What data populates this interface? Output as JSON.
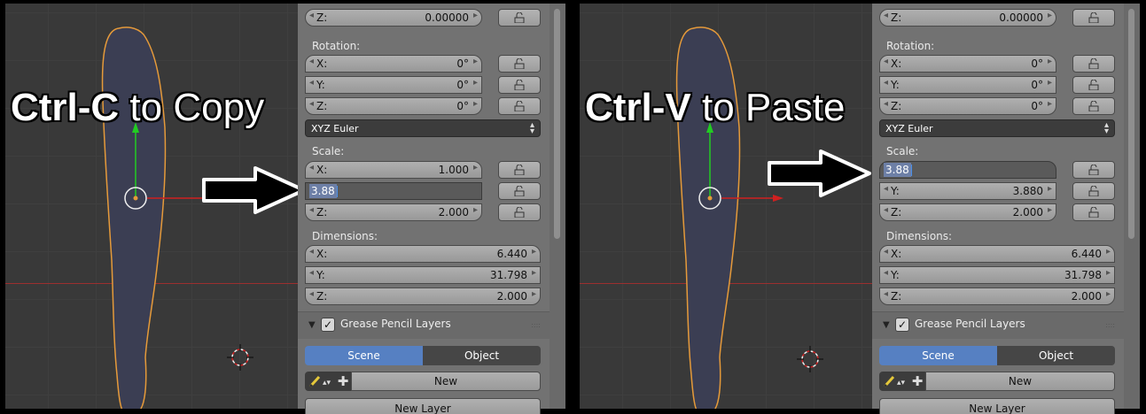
{
  "colors": {
    "selection_outline": "#e59a3a",
    "x_axis": "#d02020",
    "y_axis": "#22cc22",
    "scene_active": "#5680c2"
  },
  "left": {
    "caption": {
      "key": "Ctrl-C",
      "rest": " to Copy"
    },
    "properties": {
      "top_z": {
        "label": "Z:",
        "value": "0.00000"
      },
      "rotation": {
        "title": "Rotation:",
        "x": {
          "label": "X:",
          "value": "0°"
        },
        "y": {
          "label": "Y:",
          "value": "0°"
        },
        "z": {
          "label": "Z:",
          "value": "0°"
        }
      },
      "rotation_mode": "XYZ Euler",
      "scale": {
        "title": "Scale:",
        "x": {
          "label": "X:",
          "value": "1.000"
        },
        "y_edit": "3.88",
        "z": {
          "label": "Z:",
          "value": "2.000"
        }
      },
      "dimensions": {
        "title": "Dimensions:",
        "x": {
          "label": "X:",
          "value": "6.440"
        },
        "y": {
          "label": "Y:",
          "value": "31.798"
        },
        "z": {
          "label": "Z:",
          "value": "2.000"
        }
      },
      "grease_pencil": {
        "title": "Grease Pencil Layers",
        "scene": "Scene",
        "object": "Object",
        "new": "New",
        "new_layer": "New Layer"
      }
    }
  },
  "right": {
    "caption": {
      "key": "Ctrl-V",
      "rest": " to Paste"
    },
    "properties": {
      "top_z": {
        "label": "Z:",
        "value": "0.00000"
      },
      "rotation": {
        "title": "Rotation:",
        "x": {
          "label": "X:",
          "value": "0°"
        },
        "y": {
          "label": "Y:",
          "value": "0°"
        },
        "z": {
          "label": "Z:",
          "value": "0°"
        }
      },
      "rotation_mode": "XYZ Euler",
      "scale": {
        "title": "Scale:",
        "x_edit": "3.88",
        "y": {
          "label": "Y:",
          "value": "3.880"
        },
        "z": {
          "label": "Z:",
          "value": "2.000"
        }
      },
      "dimensions": {
        "title": "Dimensions:",
        "x": {
          "label": "X:",
          "value": "6.440"
        },
        "y": {
          "label": "Y:",
          "value": "31.798"
        },
        "z": {
          "label": "Z:",
          "value": "2.000"
        }
      },
      "grease_pencil": {
        "title": "Grease Pencil Layers",
        "scene": "Scene",
        "object": "Object",
        "new": "New",
        "new_layer": "New Layer"
      }
    }
  },
  "icons": {
    "lock": "lock-icon",
    "pencil": "pencil-icon",
    "plus": "plus-icon",
    "cursor": "3d-cursor-icon",
    "arrow": "arrow-right-icon"
  }
}
